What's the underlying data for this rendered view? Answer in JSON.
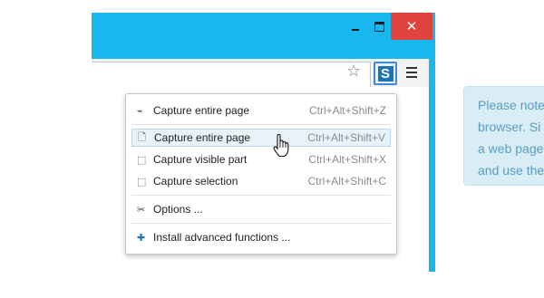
{
  "window": {
    "minimize_label": "minimize",
    "maximize_label": "maximize",
    "close_label": "✕"
  },
  "toolbar": {
    "bookmark_icon": "star-icon",
    "extension_icon": "screenshot-extension-icon",
    "extension_letter": "S",
    "menu_icon": "hamburger-menu-icon"
  },
  "menu": {
    "items": [
      {
        "icon": "capture-entire-page-quick-icon",
        "label": "Capture entire page",
        "shortcut": "Ctrl+Alt+Shift+Z"
      },
      {
        "icon": "page-icon",
        "label": "Capture entire page",
        "shortcut": "Ctrl+Alt+Shift+V",
        "hovered": true
      },
      {
        "icon": "visible-part-icon",
        "label": "Capture visible part",
        "shortcut": "Ctrl+Alt+Shift+X"
      },
      {
        "icon": "selection-icon",
        "label": "Capture selection",
        "shortcut": "Ctrl+Alt+Shift+C"
      },
      {
        "icon": "tools-icon",
        "label": "Options ..."
      },
      {
        "icon": "plus-icon",
        "label": "Install advanced functions ..."
      }
    ]
  },
  "notice": {
    "lines": [
      "Please note",
      "browser. Si",
      "a web page",
      "and use the"
    ]
  },
  "colors": {
    "browser_frame": "#1ab6ee",
    "close_button": "#e0433b",
    "menu_hover": "#e8f2fb",
    "notice_bg": "#d9edf7",
    "notice_text": "#5a9cc0"
  }
}
